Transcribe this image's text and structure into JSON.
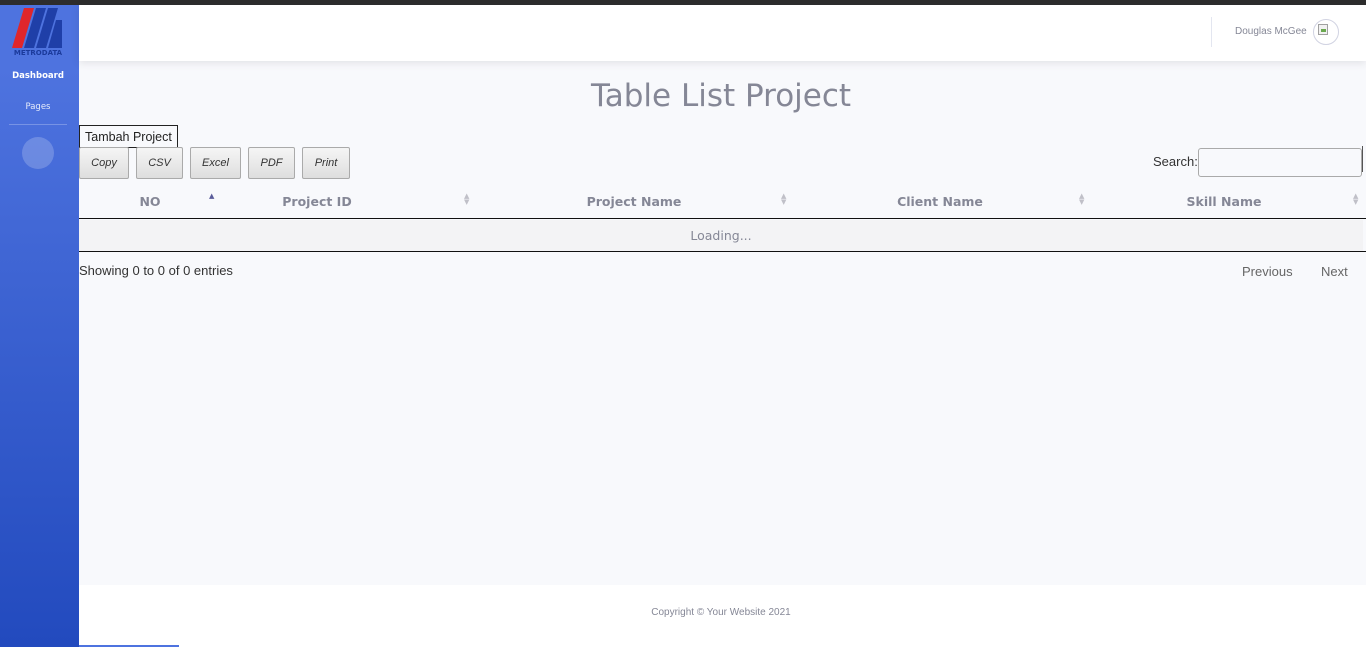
{
  "brand": {
    "name": "METRODATA"
  },
  "sidebar": {
    "items": [
      {
        "label": "Dashboard"
      },
      {
        "label": "Pages"
      }
    ],
    "toggle_icon": ""
  },
  "topbar": {
    "user_name": "Douglas McGee"
  },
  "main": {
    "title": "Table List Project",
    "add_button": "Tambah Project",
    "export_buttons": [
      "Copy",
      "CSV",
      "Excel",
      "PDF",
      "Print"
    ],
    "search_label": "Search:",
    "search_value": "",
    "table": {
      "columns": [
        "NO",
        "Project ID",
        "Project Name",
        "Client Name",
        "Skill Name"
      ],
      "sorted_column": "NO",
      "sort_direction": "ascending",
      "rows": [],
      "loading_text": "Loading..."
    },
    "info": "Showing 0 to 0 of 0 entries",
    "pagination": {
      "previous": "Previous",
      "next": "Next"
    }
  },
  "footer": {
    "copyright": "Copyright © Your Website 2021"
  },
  "colors": {
    "sidebar_top": "#4e73df",
    "sidebar_bottom": "#224abe",
    "text": "#858796",
    "background": "#f8f9fc"
  }
}
